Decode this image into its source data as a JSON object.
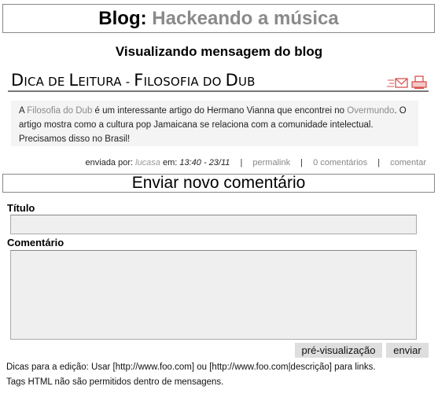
{
  "header": {
    "prefix": "Blog:",
    "blog_name": "Hackeando a música"
  },
  "view_title": "Visualizando mensagem do blog",
  "post": {
    "title_parts": [
      {
        "text": "D",
        "small": false
      },
      {
        "text": "ICA DE ",
        "small": true
      },
      {
        "text": "L",
        "small": false
      },
      {
        "text": "EITURA - ",
        "small": true
      },
      {
        "text": "F",
        "small": false
      },
      {
        "text": "ILOSOFIA DO ",
        "small": true
      },
      {
        "text": "D",
        "small": false
      },
      {
        "text": "UB",
        "small": true
      }
    ],
    "body": {
      "t1": "A ",
      "link1": "Filosofia do Dub",
      "t2": " é um interessante artigo do Hermano Vianna que encontrei no ",
      "link2": "Overmundo",
      "t3": ". O artigo mostra como a cultura pop Jamaicana se relaciona com a comunidade intelectual. Precisamos disso no Brasil!"
    },
    "meta": {
      "sent_by": "enviada por:",
      "author": "lucasa",
      "at": "em:",
      "datetime": "13:40 - 23/11",
      "sep": "|",
      "permalink": "permalink",
      "comments": "0 comentários",
      "comment": "comentar"
    },
    "icons": [
      "email-icon",
      "print-icon"
    ]
  },
  "comment_form": {
    "header": "Enviar novo comentário",
    "title_label": "Título",
    "title_value": "",
    "comment_label": "Comentário",
    "comment_value": "",
    "preview_button": "pré-visualização",
    "send_button": "enviar"
  },
  "tips": {
    "line1": "Dicas para a edição: Usar [http://www.foo.com] ou [http://www.foo.com|descrição] para links.",
    "line2": "Tags HTML não são permitidos dentro de mensagens."
  },
  "colors": {
    "link": "#8a8a8a",
    "icon_red": "#d9534f",
    "field_bg": "#efefef",
    "button_bg": "#dedede"
  }
}
